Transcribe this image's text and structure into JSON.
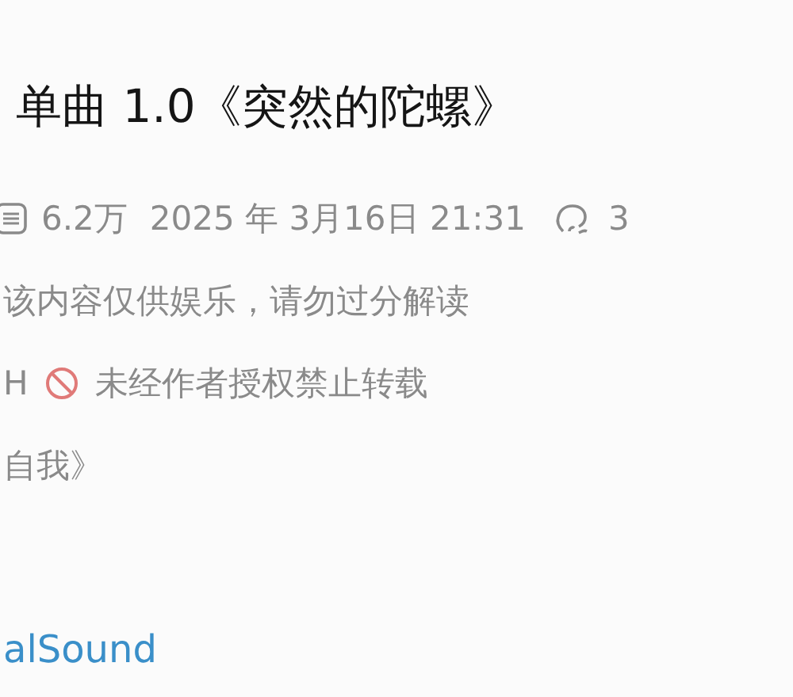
{
  "title": "单曲 1.0《突然的陀螺》",
  "meta": {
    "views": "6.2万",
    "date": "2025 年 3月16日 21:31",
    "comments": "3"
  },
  "notice": "该内容仅供娱乐，请勿过分解读",
  "rights": {
    "prefix": "H",
    "text": "未经作者授权禁止转载"
  },
  "line": "自我》",
  "link": "alSound"
}
